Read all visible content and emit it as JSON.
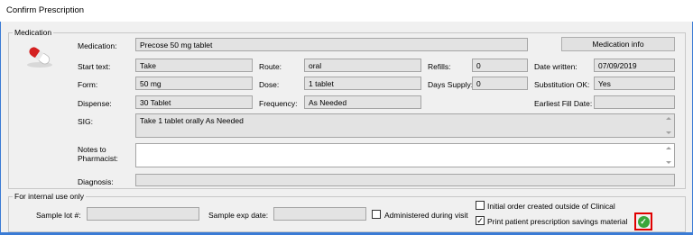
{
  "window": {
    "title": "Confirm Prescription"
  },
  "medication_group": {
    "legend": "Medication",
    "medication_label": "Medication:",
    "medication_value": "Precose 50 mg tablet",
    "medication_info_button": "Medication info",
    "start_text_label": "Start text:",
    "start_text_value": "Take",
    "route_label": "Route:",
    "route_value": "oral",
    "refills_label": "Refills:",
    "refills_value": "0",
    "date_written_label": "Date written:",
    "date_written_value": "07/09/2019",
    "form_label": "Form:",
    "form_value": "50 mg",
    "dose_label": "Dose:",
    "dose_value": "1 tablet",
    "days_supply_label": "Days Supply:",
    "days_supply_value": "0",
    "substitution_label": "Substitution OK:",
    "substitution_value": "Yes",
    "dispense_label": "Dispense:",
    "dispense_value": "30 Tablet",
    "frequency_label": "Frequency:",
    "frequency_value": "As Needed",
    "earliest_fill_label": "Earliest Fill Date:",
    "earliest_fill_value": "",
    "sig_label": "SIG:",
    "sig_value": "Take 1 tablet orally As Needed",
    "notes_label_line1": "Notes to",
    "notes_label_line2": "Pharmacist:",
    "notes_value": "",
    "diagnosis_label": "Diagnosis:",
    "diagnosis_value": ""
  },
  "internal_group": {
    "legend": "For internal use only",
    "sample_lot_label": "Sample lot #:",
    "sample_lot_value": "",
    "sample_exp_label": "Sample exp date:",
    "sample_exp_value": "",
    "administered_label": "Administered during visit",
    "administered_checked": false,
    "initial_order_label": "Initial order created outside of Clinical",
    "initial_order_checked": false,
    "print_savings_label": "Print patient prescription savings material",
    "print_savings_checked": true
  },
  "icons": {
    "medication": "pill-capsule-icon",
    "print_savings_status": "green-checkmark-icon"
  },
  "colors": {
    "highlight": "#e00000",
    "status_green": "#3aa63a",
    "window_border": "#3a7bd5"
  }
}
